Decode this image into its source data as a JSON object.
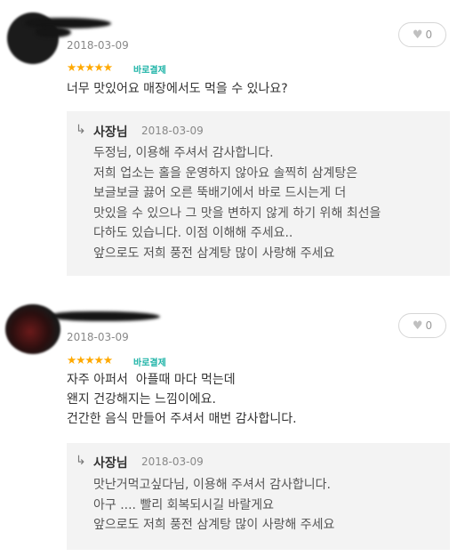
{
  "reviews": [
    {
      "date": "2018-03-09",
      "stars": "★★★★★",
      "badge": "바로결제",
      "text": "너무 맛있어요 매장에서도 먹을 수 있나요?",
      "likes": "0",
      "reply": {
        "owner": "사장님",
        "date": "2018-03-09",
        "text": "두정님, 이용해 주셔서 감사합니다.\n저희 업소는 홀을 운영하지 않아요 솔찍히 삼계탕은\n보글보글 끓어 오른 뚝배기에서 바로 드시는게 더\n맛있을 수 있으나 그 맛을 변하지 않게 하기 위해 최선을\n다하도 있습니다. 이점 이해해 주세요..\n앞으로도 저희 풍전 삼계탕 많이 사랑해 주세요"
      }
    },
    {
      "date": "2018-03-09",
      "stars": "★★★★★",
      "badge": "바로결제",
      "text": "자주 아퍼서  아플때 마다 먹는데\n왠지 건강해지는 느낌이에요.\n건간한 음식 만들어 주셔서 매번 감사합니다.",
      "likes": "0",
      "reply": {
        "owner": "사장님",
        "date": "2018-03-09",
        "text": "맛난거먹고싶다님, 이용해 주셔서 감사합니다.\n아구 .... 빨리 회복되시길 바랄게요\n앞으로도 저희 풍전 삼계탕 많이 사랑해 주세요"
      }
    }
  ],
  "icons": {
    "like": "heart-icon",
    "reply": "reply-arrow-icon",
    "star": "star-icon"
  },
  "colors": {
    "star": "#ffa900",
    "badge": "#20b4a8",
    "reply_bg": "#f3f3f3"
  }
}
